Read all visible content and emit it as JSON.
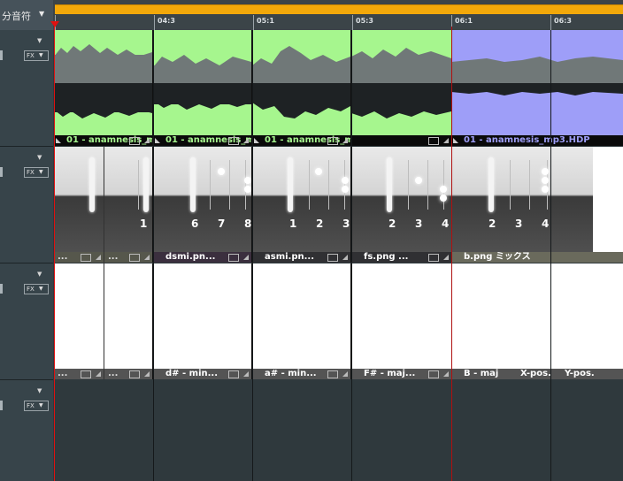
{
  "header": {
    "title": "分音符",
    "dropdown_icon": "triangle-down-icon"
  },
  "ruler": {
    "ticks": [
      {
        "label": "",
        "pos": 0
      },
      {
        "label": "04:3",
        "pos": 112
      },
      {
        "label": "05:1",
        "pos": 224
      },
      {
        "label": "05:3",
        "pos": 336
      },
      {
        "label": "06:1",
        "pos": 448
      },
      {
        "label": "06:3",
        "pos": 560
      }
    ]
  },
  "tracks": [
    {
      "fx": "FX",
      "dropdown": "chevron-down-icon"
    },
    {
      "fx": "FX",
      "dropdown": "chevron-down-icon"
    },
    {
      "fx": "FX",
      "dropdown": "chevron-down-icon"
    },
    {
      "fx": "FX",
      "dropdown": "chevron-down-icon"
    }
  ],
  "audio_clips": [
    {
      "name": "01 - anamnesis_mp3.HDP ...",
      "color": "#a6f68e"
    },
    {
      "name": "01 - anamnesis_mp3.HDP ...",
      "color": "#a6f68e"
    },
    {
      "name": "01 - anamnesis_mp3.HDP ...",
      "color": "#a6f68e"
    },
    {
      "name": "01 - anamnesis_mp3.HDP",
      "color": "#9e9ef8"
    }
  ],
  "image_clips": [
    {
      "name": "...",
      "numbers": []
    },
    {
      "name": "...",
      "numbers": [
        "1"
      ]
    },
    {
      "name": "dsmi.pn...",
      "numbers": [
        "6",
        "7",
        "8"
      ]
    },
    {
      "name": "asmi.pn...",
      "numbers": [
        "1",
        "2",
        "3"
      ]
    },
    {
      "name": "fs.png ...",
      "numbers": [
        "2",
        "3",
        "4"
      ]
    },
    {
      "name": "b.png ミックス",
      "numbers": [
        "2",
        "3",
        "4"
      ]
    }
  ],
  "text_clips": [
    {
      "name": "..."
    },
    {
      "name": "..."
    },
    {
      "name": "d# - min..."
    },
    {
      "name": "a# - min..."
    },
    {
      "name": "F# - maj..."
    },
    {
      "name": "B - maj"
    },
    {
      "name": "X-pos."
    },
    {
      "name": "Y-pos."
    }
  ],
  "colors": {
    "accent": "#f2a80a",
    "playhead": "#e01010",
    "audio_green": "#a6f68e",
    "audio_purple": "#9e9ef8"
  }
}
